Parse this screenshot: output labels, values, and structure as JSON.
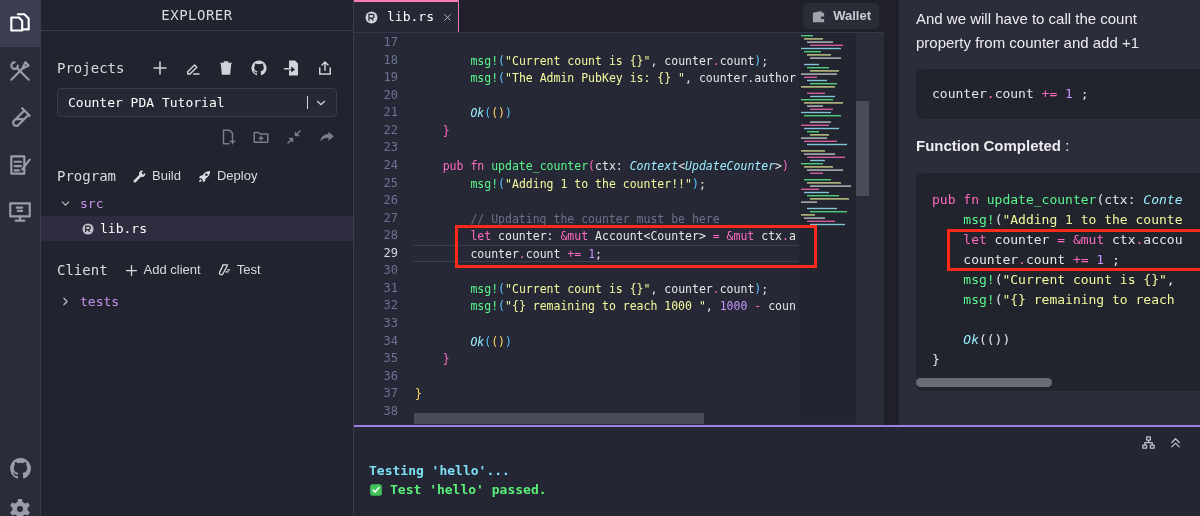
{
  "activity_bar": {
    "items": [
      {
        "selected": true
      },
      {
        "selected": false
      },
      {
        "selected": false
      },
      {
        "selected": false
      },
      {
        "selected": false
      }
    ]
  },
  "explorer": {
    "title": "EXPLORER",
    "projects": {
      "label": "Projects",
      "selected_project": "Counter PDA Tutorial"
    },
    "program": {
      "label": "Program",
      "actions": [
        "Build",
        "Deploy"
      ]
    },
    "program_tree": [
      {
        "label": "src",
        "expanded": true,
        "selected": false,
        "children": [
          {
            "label": "lib.rs",
            "selected": true
          }
        ]
      }
    ],
    "client": {
      "label": "Client",
      "actions": [
        "Add client",
        "Test"
      ]
    },
    "client_tree": [
      {
        "label": "tests",
        "expanded": false,
        "selected": false
      }
    ]
  },
  "editor": {
    "tabs": [
      {
        "label": "lib.rs",
        "selected": true
      }
    ],
    "wallet_button": "Wallet",
    "lines": [
      {
        "number": "17",
        "current": false,
        "boxed": false
      },
      {
        "number": "18",
        "current": false,
        "boxed": false,
        "tokens": [
          {
            "kind": "fn",
            "text": "        msg!"
          },
          {
            "kind": "b1",
            "text": "("
          },
          {
            "kind": "str",
            "text": "\"Current count is {}\""
          },
          {
            "kind": "plain",
            "text": ", counter"
          },
          {
            "kind": "kw",
            "text": "."
          },
          {
            "kind": "plain",
            "text": "count"
          },
          {
            "kind": "b1",
            "text": ")"
          },
          {
            "kind": "plain",
            "text": ";"
          }
        ]
      },
      {
        "number": "19",
        "current": false,
        "boxed": false,
        "tokens": [
          {
            "kind": "fn",
            "text": "        msg!"
          },
          {
            "kind": "b1",
            "text": "("
          },
          {
            "kind": "str",
            "text": "\"The Admin PubKey is: {} \""
          },
          {
            "kind": "plain",
            "text": ", counter.author"
          }
        ]
      },
      {
        "number": "20",
        "current": false,
        "boxed": false
      },
      {
        "number": "21",
        "current": false,
        "boxed": false,
        "tokens": [
          {
            "kind": "type",
            "text": "        Ok"
          },
          {
            "kind": "b1",
            "text": "("
          },
          {
            "kind": "b2",
            "text": "()"
          },
          {
            "kind": "b1",
            "text": ")"
          }
        ]
      },
      {
        "number": "22",
        "current": false,
        "boxed": false,
        "tokens": [
          {
            "kind": "b3",
            "text": "    }"
          }
        ]
      },
      {
        "number": "23",
        "current": false,
        "boxed": false
      },
      {
        "number": "24",
        "current": false,
        "boxed": false,
        "tokens": [
          {
            "kind": "kw",
            "text": "    pub fn "
          },
          {
            "kind": "fn",
            "text": "update_counter"
          },
          {
            "kind": "b3",
            "text": "("
          },
          {
            "kind": "plain",
            "text": "ctx: "
          },
          {
            "kind": "type",
            "text": "Context"
          },
          {
            "kind": "plain",
            "text": "<"
          },
          {
            "kind": "type",
            "text": "UpdateCounter"
          },
          {
            "kind": "plain",
            "text": ">"
          },
          {
            "kind": "b3",
            "text": ")"
          }
        ]
      },
      {
        "number": "25",
        "current": false,
        "boxed": false,
        "tokens": [
          {
            "kind": "fn",
            "text": "        msg!"
          },
          {
            "kind": "b1",
            "text": "("
          },
          {
            "kind": "str",
            "text": "\"Adding 1 to the counter!!\""
          },
          {
            "kind": "b1",
            "text": ")"
          },
          {
            "kind": "plain",
            "text": ";"
          }
        ]
      },
      {
        "number": "26",
        "current": false,
        "boxed": false
      },
      {
        "number": "27",
        "current": false,
        "boxed": false,
        "tokens": [
          {
            "kind": "comment",
            "text": "        // Updating the counter must be here"
          }
        ]
      },
      {
        "number": "28",
        "current": false,
        "boxed": true,
        "tokens": [
          {
            "kind": "kw",
            "text": "        let"
          },
          {
            "kind": "plain",
            "text": " counter: "
          },
          {
            "kind": "kw",
            "text": "&mut"
          },
          {
            "kind": "plain",
            "text": " Account<Counter> "
          },
          {
            "kind": "kw",
            "text": "= &mut"
          },
          {
            "kind": "plain",
            "text": " ctx"
          },
          {
            "kind": "kw",
            "text": "."
          },
          {
            "kind": "plain",
            "text": "a"
          }
        ]
      },
      {
        "number": "29",
        "current": true,
        "boxed": true,
        "tokens": [
          {
            "kind": "plain",
            "text": "        counter"
          },
          {
            "kind": "kw",
            "text": "."
          },
          {
            "kind": "plain",
            "text": "count "
          },
          {
            "kind": "kw",
            "text": "+="
          },
          {
            "kind": "num",
            "text": " 1"
          },
          {
            "kind": "plain",
            "text": ";"
          }
        ]
      },
      {
        "number": "30",
        "current": false,
        "boxed": false
      },
      {
        "number": "31",
        "current": false,
        "boxed": false,
        "tokens": [
          {
            "kind": "fn",
            "text": "        msg!"
          },
          {
            "kind": "b1",
            "text": "("
          },
          {
            "kind": "str",
            "text": "\"Current count is {}\""
          },
          {
            "kind": "plain",
            "text": ", counter"
          },
          {
            "kind": "kw",
            "text": "."
          },
          {
            "kind": "plain",
            "text": "count"
          },
          {
            "kind": "b1",
            "text": ")"
          },
          {
            "kind": "plain",
            "text": ";"
          }
        ]
      },
      {
        "number": "32",
        "current": false,
        "boxed": false,
        "tokens": [
          {
            "kind": "fn",
            "text": "        msg!"
          },
          {
            "kind": "b1",
            "text": "("
          },
          {
            "kind": "str",
            "text": "\"{} remaining to reach 1000 \""
          },
          {
            "kind": "plain",
            "text": ", "
          },
          {
            "kind": "num",
            "text": "1000"
          },
          {
            "kind": "kw",
            "text": " -"
          },
          {
            "kind": "plain",
            "text": " coun"
          }
        ]
      },
      {
        "number": "33",
        "current": false,
        "boxed": false
      },
      {
        "number": "34",
        "current": false,
        "boxed": false,
        "tokens": [
          {
            "kind": "type",
            "text": "        Ok"
          },
          {
            "kind": "b1",
            "text": "("
          },
          {
            "kind": "b2",
            "text": "()"
          },
          {
            "kind": "b1",
            "text": ")"
          }
        ]
      },
      {
        "number": "35",
        "current": false,
        "boxed": false,
        "tokens": [
          {
            "kind": "b3",
            "text": "    }"
          }
        ]
      },
      {
        "number": "36",
        "current": false,
        "boxed": false
      },
      {
        "number": "37",
        "current": false,
        "boxed": false,
        "tokens": [
          {
            "kind": "b2",
            "text": "}"
          }
        ]
      },
      {
        "number": "38",
        "current": false,
        "boxed": false
      }
    ]
  },
  "tutorial": {
    "blocks": [
      {
        "kind": "paragraph",
        "text": "And we will have to call the count property from counter and add +1"
      },
      {
        "kind": "code",
        "lines": [
          {
            "boxed": false,
            "tokens": [
              {
                "kind": "plain",
                "text": "counter"
              },
              {
                "kind": "kw",
                "text": "."
              },
              {
                "kind": "plain",
                "text": "count "
              },
              {
                "kind": "kw",
                "text": "+="
              },
              {
                "kind": "num",
                "text": " 1"
              },
              {
                "kind": "plain",
                "text": " ;"
              }
            ]
          }
        ]
      },
      {
        "kind": "heading",
        "text": "**Function Completed** :"
      },
      {
        "kind": "code",
        "lines": [
          {
            "boxed": false,
            "tokens": [
              {
                "kind": "kw",
                "text": "pub fn "
              },
              {
                "kind": "fn",
                "text": "update_counter"
              },
              {
                "kind": "plain",
                "text": "(ctx: "
              },
              {
                "kind": "type",
                "text": "Conte"
              }
            ]
          },
          {
            "boxed": false,
            "tokens": [
              {
                "kind": "fn",
                "text": "    msg!"
              },
              {
                "kind": "plain",
                "text": "("
              },
              {
                "kind": "str",
                "text": "\"Adding 1 to the counte"
              }
            ]
          },
          {
            "boxed": true,
            "tokens": [
              {
                "kind": "kw",
                "text": "    let"
              },
              {
                "kind": "plain",
                "text": " counter "
              },
              {
                "kind": "kw",
                "text": "= &mut"
              },
              {
                "kind": "plain",
                "text": " ctx"
              },
              {
                "kind": "kw",
                "text": "."
              },
              {
                "kind": "plain",
                "text": "accou"
              }
            ]
          },
          {
            "boxed": true,
            "tokens": [
              {
                "kind": "plain",
                "text": "    counter"
              },
              {
                "kind": "kw",
                "text": "."
              },
              {
                "kind": "plain",
                "text": "count "
              },
              {
                "kind": "kw",
                "text": "+="
              },
              {
                "kind": "num",
                "text": " 1"
              },
              {
                "kind": "plain",
                "text": " ;"
              }
            ]
          },
          {
            "boxed": false,
            "tokens": [
              {
                "kind": "fn",
                "text": "    msg!"
              },
              {
                "kind": "plain",
                "text": "("
              },
              {
                "kind": "str",
                "text": "\"Current count is {}\""
              },
              {
                "kind": "plain",
                "text": ","
              }
            ]
          },
          {
            "boxed": false,
            "tokens": [
              {
                "kind": "fn",
                "text": "    msg!"
              },
              {
                "kind": "plain",
                "text": "("
              },
              {
                "kind": "str",
                "text": "\"{} remaining to reach"
              }
            ]
          },
          {
            "boxed": false
          },
          {
            "boxed": false,
            "tokens": [
              {
                "kind": "type",
                "text": "    Ok"
              },
              {
                "kind": "plain",
                "text": "(())"
              }
            ]
          },
          {
            "boxed": false,
            "tokens": [
              {
                "kind": "plain",
                "text": "}"
              }
            ]
          }
        ]
      }
    ]
  },
  "terminal": {
    "lines": [
      {
        "kind": "info",
        "text": "Testing 'hello'..."
      },
      {
        "kind": "success",
        "text": "Test 'hello' passed."
      }
    ]
  }
}
